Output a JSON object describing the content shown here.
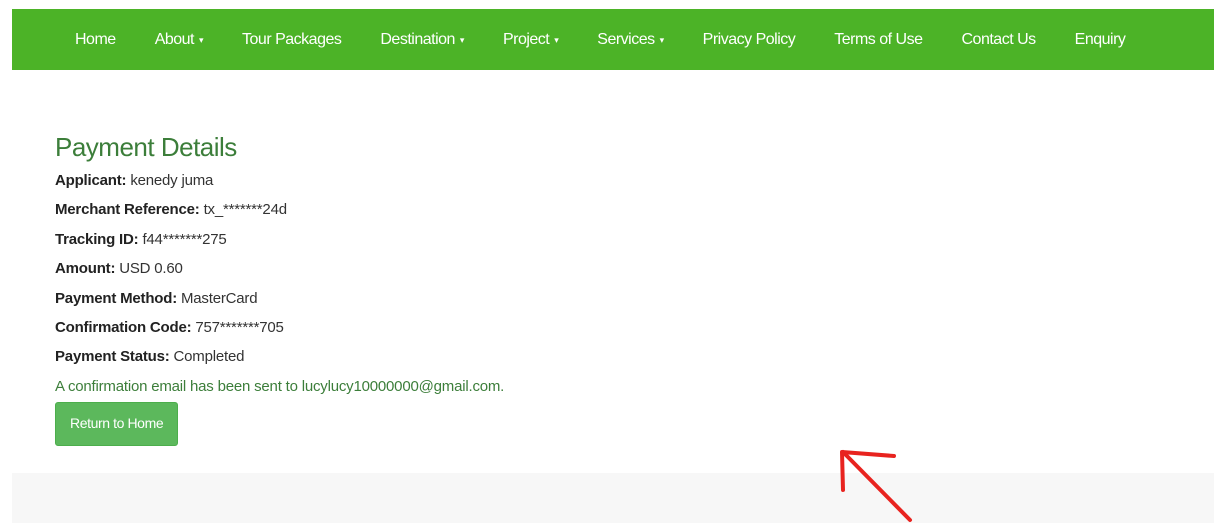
{
  "nav": {
    "items": [
      {
        "label": "Home",
        "dropdown": false
      },
      {
        "label": "About",
        "dropdown": true
      },
      {
        "label": "Tour Packages",
        "dropdown": false
      },
      {
        "label": "Destination",
        "dropdown": true
      },
      {
        "label": "Project",
        "dropdown": true
      },
      {
        "label": "Services",
        "dropdown": true
      },
      {
        "label": "Privacy Policy",
        "dropdown": false
      },
      {
        "label": "Terms of Use",
        "dropdown": false
      },
      {
        "label": "Contact Us",
        "dropdown": false
      },
      {
        "label": "Enquiry",
        "dropdown": false
      }
    ],
    "caret_glyph": "▾",
    "background": "#4cb327"
  },
  "payment": {
    "title": "Payment Details",
    "fields": [
      {
        "label": "Applicant:",
        "value": "kenedy juma"
      },
      {
        "label": "Merchant Reference:",
        "value": "tx_*******24d"
      },
      {
        "label": "Tracking ID:",
        "value": "f44*******275"
      },
      {
        "label": "Amount:",
        "value": "USD 0.60"
      },
      {
        "label": "Payment Method:",
        "value": "MasterCard"
      },
      {
        "label": "Confirmation Code:",
        "value": "757*******705"
      },
      {
        "label": "Payment Status:",
        "value": "Completed"
      }
    ],
    "confirmation_message": "A confirmation email has been sent to lucylucy10000000@gmail.com.",
    "return_button_label": "Return to Home"
  },
  "colors": {
    "heading": "#3c7e3a",
    "button": "#5cb85c",
    "annotation_arrow": "#e8231f"
  },
  "annotation": {
    "icon": "red-arrow-annotation"
  }
}
